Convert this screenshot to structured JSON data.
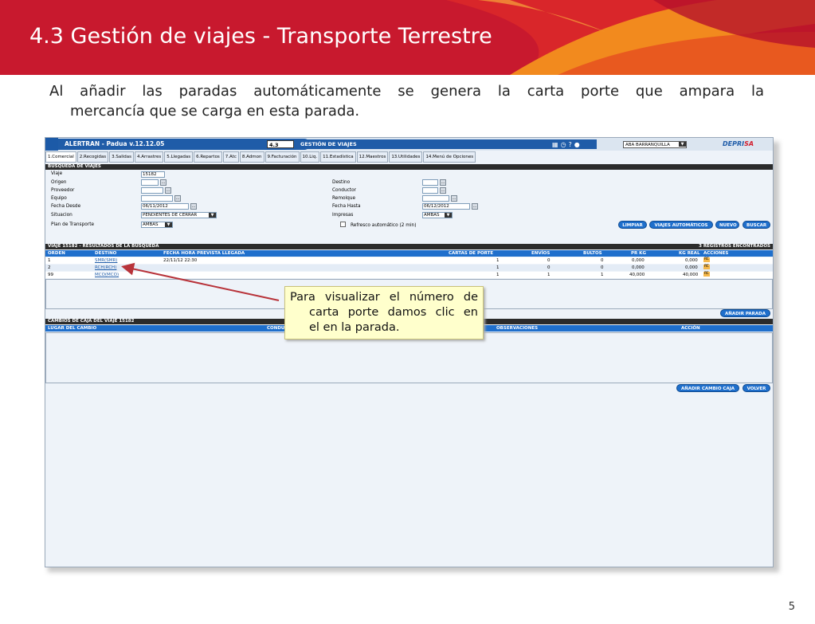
{
  "slide": {
    "title": "4.3 Gestión de viajes - Transporte Terrestre",
    "intro_line1": "Al añadir las paradas automáticamente se genera la carta porte que ampara la",
    "intro_line2": "mercancía que se carga en esta parada.",
    "page_number": "5",
    "colors": {
      "banner": "#c8192e",
      "accent_orange": "#f28a1e",
      "app_blue": "#1f5ca8"
    }
  },
  "app": {
    "title": "ALERTRAN - Padua  v.12.12.05",
    "module_code": "4.3",
    "module_name": "GESTIÓN DE VIAJES",
    "top_icons": [
      "calendar-icon",
      "clock-icon",
      "help-icon",
      "user-icon"
    ],
    "branch": "ABA BARRANQUILLA",
    "brand": {
      "part1": "DEPRI",
      "part2": "SA"
    },
    "menu": [
      "1.Comercial",
      "2.Recogidas",
      "3.Salidas",
      "4.Arrastres",
      "5.Llegadas",
      "6.Repartos",
      "7.Atc",
      "8.Admon",
      "9.Facturación",
      "10.Liq.",
      "11.Estadística",
      "12.Maestros",
      "13.Utilidades",
      "14.Menú de Opciones"
    ],
    "search": {
      "section_title": "BÚSQUEDA DE VIAJES",
      "labels": {
        "viaje": "Viaje",
        "origen": "Origen",
        "proveedor": "Proveedor",
        "equipo": "Equipo",
        "fecha_desde": "Fecha Desde",
        "situacion": "Situacion",
        "plan": "Plan de Transporte",
        "destino": "Destino",
        "conductor": "Conductor",
        "remolque": "Remolque",
        "fecha_hasta": "Fecha Hasta",
        "impresas": "Impresas",
        "refresco": "Refresco automático (2 min)"
      },
      "values": {
        "viaje": "15182",
        "fecha_desde": "06/11/2012",
        "situacion": "PENDIENTES DE CERRAR",
        "plan": "AMBAS",
        "fecha_hasta": "06/12/2012",
        "impresas": "AMBAS"
      },
      "buttons": {
        "limpiar": "LIMPIAR",
        "viajes_auto": "VIAJES AUTOMÁTICOS",
        "nuevo": "NUEVO",
        "buscar": "BUSCAR"
      }
    },
    "results": {
      "section_title": "VIAJE 15182 - RESULTADOS DE LA BÚSQUEDA",
      "count": "3 REGISTROS ENCONTRADOS",
      "columns": [
        "ORDEN",
        "DESTINO",
        "FECHA HORA PREVISTA LLEGADA",
        "CARTAS DE PORTE",
        "ENVÍOS",
        "BULTOS",
        "PR KG",
        "KG REAL",
        "ACCIONES"
      ],
      "rows": [
        {
          "orden": "1",
          "destino": "SMR(SMR)",
          "fecha": "22/11/12 22:30",
          "cartas": "1",
          "envios": "0",
          "bultos": "0",
          "pr_kg": "0,000",
          "kg_real": "0,000"
        },
        {
          "orden": "2",
          "destino": "RCH(RCH)",
          "fecha": "",
          "cartas": "1",
          "envios": "0",
          "bultos": "0",
          "pr_kg": "0,000",
          "kg_real": "0,000"
        },
        {
          "orden": "99",
          "destino": "MCO(MCO)",
          "fecha": "",
          "cartas": "1",
          "envios": "1",
          "bultos": "1",
          "pr_kg": "40,000",
          "kg_real": "40,000"
        }
      ],
      "actions": [
        "EO",
        "ED",
        "RL"
      ],
      "add_stop_button": "AÑADIR PARADA"
    },
    "changes": {
      "section_title": "CAMBIOS DE CAJA DEL VIAJE 15182",
      "columns": [
        "LUGAR DEL CAMBIO",
        "CONDU",
        "OBSERVACIONES",
        "ACCIÓN"
      ],
      "add_button": "AÑADIR CAMBIO CAJA",
      "back_button": "VOLVER"
    }
  },
  "callout": {
    "line1": "Para visualizar el número de",
    "line2": "carta porte damos clic en",
    "line3": "el en la parada."
  }
}
